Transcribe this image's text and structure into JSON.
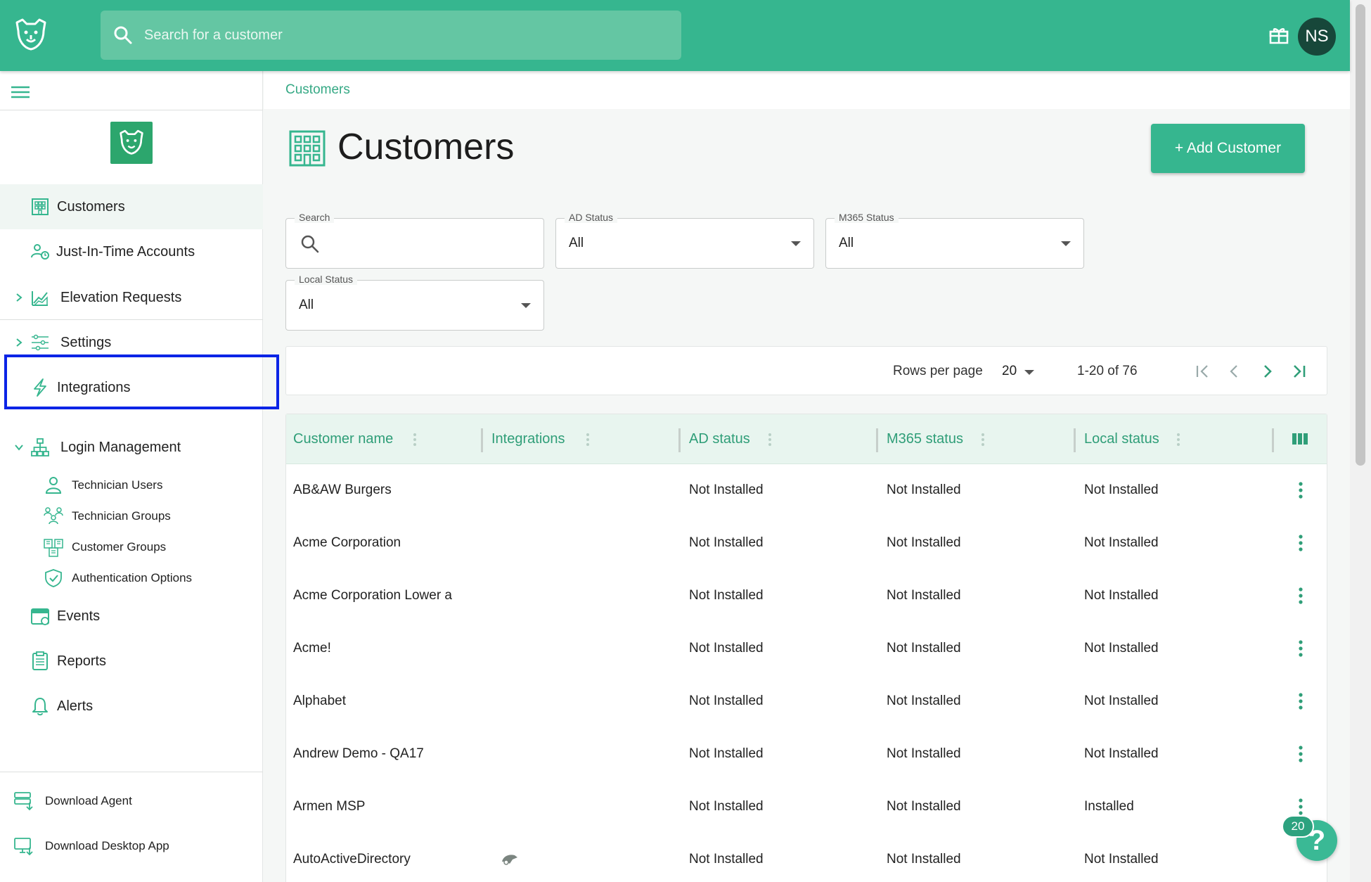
{
  "topbar": {
    "search_placeholder": "Search for a customer",
    "avatar_initials": "NS",
    "brand_color": "#36b68f"
  },
  "sidebar": {
    "items": [
      {
        "label": "Customers",
        "icon": "building-icon",
        "active": true
      },
      {
        "label": "Just-In-Time Accounts",
        "icon": "users-clock-icon"
      },
      {
        "label": "Elevation Requests",
        "icon": "chart-up-icon",
        "expandable": true
      },
      {
        "label": "Settings",
        "icon": "sliders-icon",
        "expandable": true
      },
      {
        "label": "Integrations",
        "icon": "lightning-icon"
      },
      {
        "label": "Login Management",
        "icon": "hierarchy-icon",
        "expanded": true
      },
      {
        "label": "Events",
        "icon": "calendar-icon"
      },
      {
        "label": "Reports",
        "icon": "clipboard-icon"
      },
      {
        "label": "Alerts",
        "icon": "bell-icon"
      }
    ],
    "sub_items": [
      {
        "label": "Technician Users",
        "icon": "user-icon"
      },
      {
        "label": "Technician Groups",
        "icon": "user-group-icon"
      },
      {
        "label": "Customer Groups",
        "icon": "buildings-icon"
      },
      {
        "label": "Authentication Options",
        "icon": "shield-check-icon"
      }
    ],
    "bottom": [
      {
        "label": "Download Agent",
        "icon": "server-download-icon"
      },
      {
        "label": "Download Desktop App",
        "icon": "monitor-download-icon"
      }
    ]
  },
  "main": {
    "breadcrumb": "Customers",
    "title": "Customers",
    "add_button": "+ Add Customer",
    "filters": {
      "search_label": "Search",
      "ad_label": "AD Status",
      "ad_value": "All",
      "m365_label": "M365 Status",
      "m365_value": "All",
      "local_label": "Local Status",
      "local_value": "All"
    },
    "pager": {
      "rows_per_page_label": "Rows per page",
      "rows_per_page": "20",
      "range": "1-20 of 76"
    },
    "table": {
      "columns": [
        "Customer name",
        "Integrations",
        "AD status",
        "M365 status",
        "Local status"
      ],
      "rows": [
        {
          "name": "AB&AW Burgers",
          "ad": "Not Installed",
          "m365": "Not Installed",
          "local": "Not Installed"
        },
        {
          "name": "Acme Corporation",
          "ad": "Not Installed",
          "m365": "Not Installed",
          "local": "Not Installed"
        },
        {
          "name": "Acme Corporation Lower a",
          "ad": "Not Installed",
          "m365": "Not Installed",
          "local": "Not Installed"
        },
        {
          "name": "Acme!",
          "ad": "Not Installed",
          "m365": "Not Installed",
          "local": "Not Installed"
        },
        {
          "name": "Alphabet",
          "ad": "Not Installed",
          "m365": "Not Installed",
          "local": "Not Installed"
        },
        {
          "name": "Andrew Demo - QA17",
          "ad": "Not Installed",
          "m365": "Not Installed",
          "local": "Not Installed"
        },
        {
          "name": "Armen MSP",
          "ad": "Not Installed",
          "m365": "Not Installed",
          "local": "Installed"
        },
        {
          "name": "AutoActiveDirectory",
          "ad": "Not Installed",
          "m365": "Not Installed",
          "local": "Not Installed",
          "integration_icon": "connectwise-icon"
        }
      ]
    }
  },
  "help": {
    "badge": "20",
    "icon": "?"
  }
}
